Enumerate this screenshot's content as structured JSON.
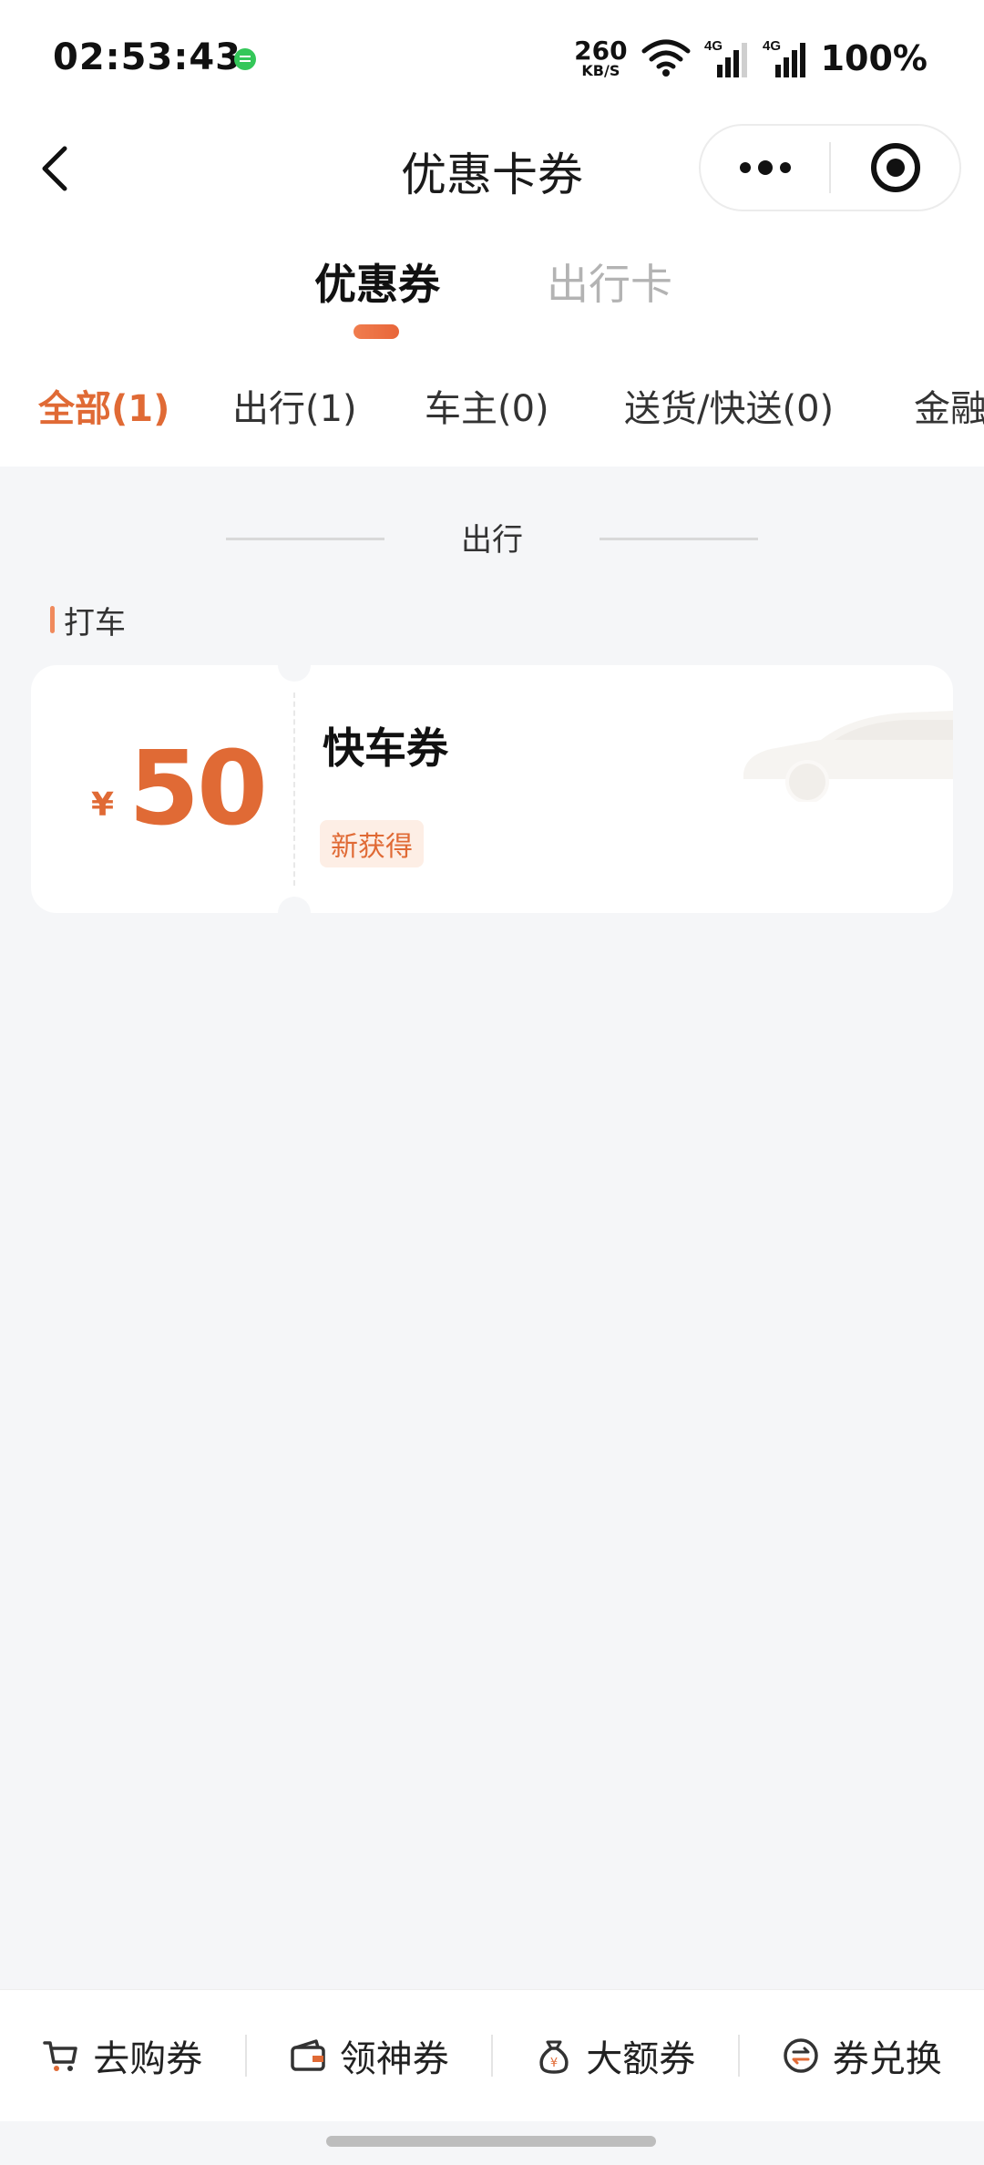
{
  "status_bar": {
    "time": "02:53:43",
    "net_speed_value": "260",
    "net_speed_unit": "KB/S",
    "network_1": "4G",
    "network_2": "4G",
    "battery": "100%"
  },
  "nav": {
    "title": "优惠卡券",
    "icons": [
      "back-icon",
      "more-icon",
      "target-icon"
    ]
  },
  "main_tabs": [
    {
      "label": "优惠券",
      "active": true
    },
    {
      "label": "出行卡",
      "active": false
    }
  ],
  "category_tabs": [
    {
      "label": "全部(1)",
      "active": true
    },
    {
      "label": "出行(1)",
      "active": false
    },
    {
      "label": "车主(0)",
      "active": false
    },
    {
      "label": "送货/快送(0)",
      "active": false
    },
    {
      "label": "金融",
      "active": false
    }
  ],
  "section": {
    "title": "出行",
    "subsection": "打车"
  },
  "coupons": [
    {
      "currency": "¥",
      "amount": "50",
      "name": "快车券",
      "badge": "新获得"
    }
  ],
  "bottom_bar": [
    {
      "label": "去购券",
      "icon": "cart-icon"
    },
    {
      "label": "领神券",
      "icon": "wallet-icon"
    },
    {
      "label": "大额券",
      "icon": "money-bag-icon"
    },
    {
      "label": "券兑换",
      "icon": "exchange-icon"
    }
  ],
  "colors": {
    "accent": "#e06a35",
    "background": "#f5f6f8"
  }
}
